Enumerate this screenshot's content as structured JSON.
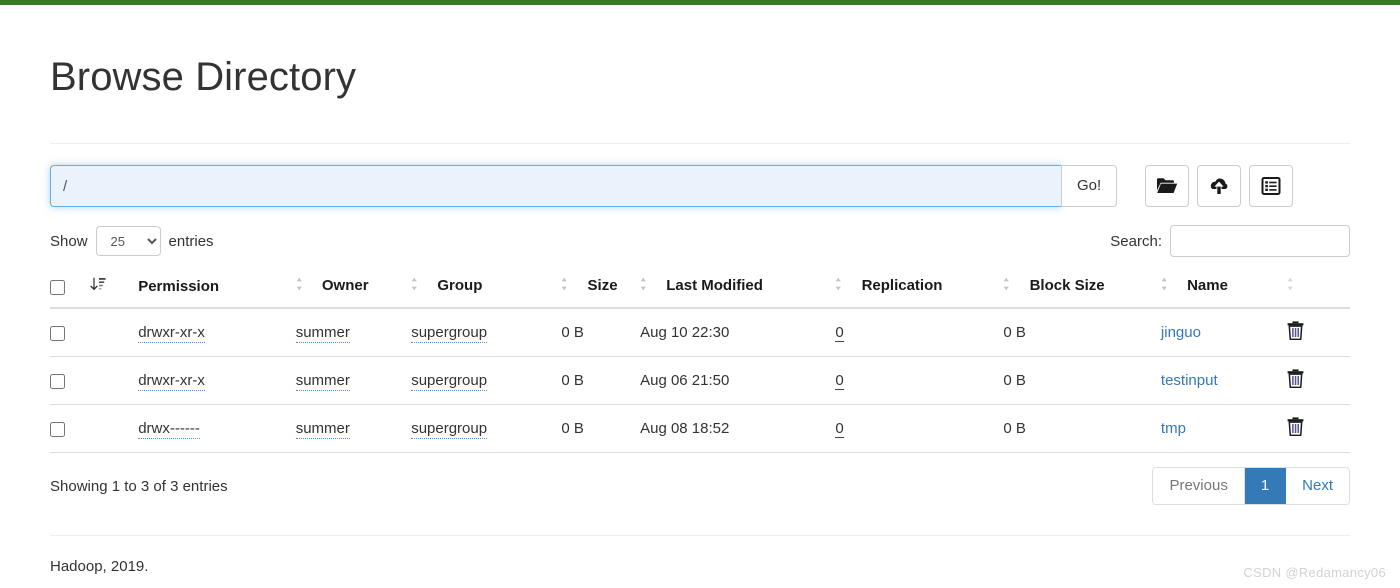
{
  "theme": {
    "topbar_color": "#3a7a25",
    "primary": "#337ab7",
    "link": "#337ab7",
    "input_focus_border": "#66afe9",
    "input_focus_bg": "#eaf2fb"
  },
  "page": {
    "title": "Browse Directory"
  },
  "path_bar": {
    "value": "/",
    "placeholder": "",
    "go_label": "Go!",
    "buttons": [
      {
        "name": "create-directory-button",
        "icon": "folder-open-icon"
      },
      {
        "name": "upload-files-button",
        "icon": "cloud-upload-icon"
      },
      {
        "name": "cut-and-paste-button",
        "icon": "list-alt-icon"
      }
    ]
  },
  "table_controls": {
    "show_label": "Show",
    "entries_label": "entries",
    "page_length": "25",
    "page_length_options": [
      "25",
      "50",
      "100"
    ],
    "search_label": "Search:",
    "search_value": "",
    "search_placeholder": ""
  },
  "table": {
    "columns": [
      {
        "label": "",
        "name": "select-all-column"
      },
      {
        "label": "",
        "name": "sort-column"
      },
      {
        "label": "Permission",
        "name": "column-permission"
      },
      {
        "label": "Owner",
        "name": "column-owner"
      },
      {
        "label": "Group",
        "name": "column-group"
      },
      {
        "label": "Size",
        "name": "column-size"
      },
      {
        "label": "Last Modified",
        "name": "column-last-modified"
      },
      {
        "label": "Replication",
        "name": "column-replication"
      },
      {
        "label": "Block Size",
        "name": "column-block-size"
      },
      {
        "label": "Name",
        "name": "column-name"
      },
      {
        "label": "",
        "name": "column-actions"
      }
    ],
    "rows": [
      {
        "permission": "drwxr-xr-x",
        "owner": "summer",
        "group": "supergroup",
        "size": "0 B",
        "last_modified": "Aug 10 22:30",
        "replication": "0",
        "block_size": "0 B",
        "name": "jinguo"
      },
      {
        "permission": "drwxr-xr-x",
        "owner": "summer",
        "group": "supergroup",
        "size": "0 B",
        "last_modified": "Aug 06 21:50",
        "replication": "0",
        "block_size": "0 B",
        "name": "testinput"
      },
      {
        "permission": "drwx------",
        "owner": "summer",
        "group": "supergroup",
        "size": "0 B",
        "last_modified": "Aug 08 18:52",
        "replication": "0",
        "block_size": "0 B",
        "name": "tmp"
      }
    ]
  },
  "table_footer": {
    "info": "Showing 1 to 3 of 3 entries",
    "pagination": {
      "previous_label": "Previous",
      "next_label": "Next",
      "pages": [
        "1"
      ],
      "active_page": "1"
    }
  },
  "footer": {
    "text": "Hadoop, 2019."
  },
  "watermark": {
    "text": "CSDN @Redamancy06"
  }
}
